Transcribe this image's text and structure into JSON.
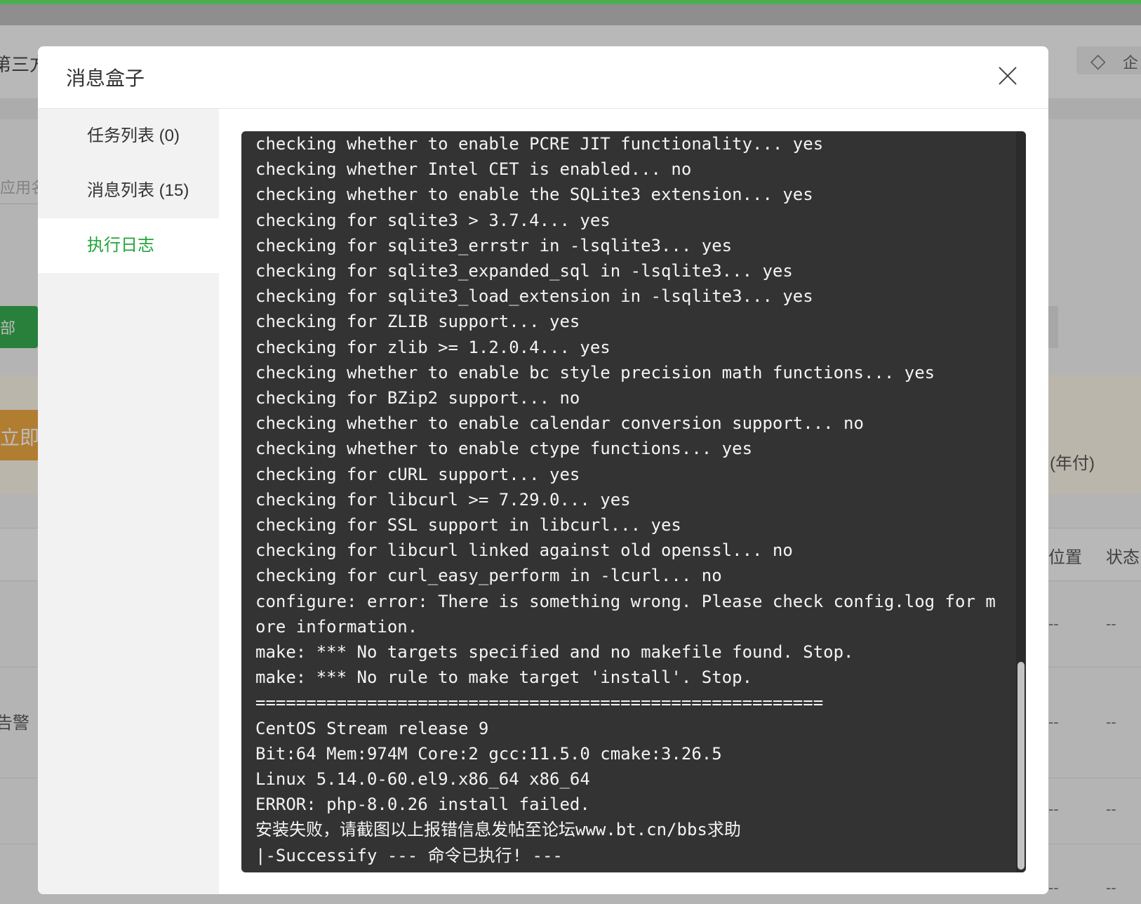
{
  "background": {
    "frag_title": "第三方",
    "frag_search": "应用名",
    "frag_green_btn": "部",
    "frag_orange_btn": "立即",
    "frag_price": "(年付)",
    "frag_col_position": "位置",
    "frag_col_status": "状态",
    "frag_alarm": "告警",
    "frag_badge": "企",
    "frag_dash": "--"
  },
  "modal": {
    "title": "消息盒子",
    "sidebar": {
      "items": [
        {
          "label": "任务列表 (0)"
        },
        {
          "label": "消息列表 (15)"
        },
        {
          "label": "执行日志"
        }
      ],
      "active_index": 2
    },
    "log_lines": [
      "checking whether to enable PCRE JIT functionality... yes",
      "checking whether Intel CET is enabled... no",
      "checking whether to enable the SQLite3 extension... yes",
      "checking for sqlite3 > 3.7.4... yes",
      "checking for sqlite3_errstr in -lsqlite3... yes",
      "checking for sqlite3_expanded_sql in -lsqlite3... yes",
      "checking for sqlite3_load_extension in -lsqlite3... yes",
      "checking for ZLIB support... yes",
      "checking for zlib >= 1.2.0.4... yes",
      "checking whether to enable bc style precision math functions... yes",
      "checking for BZip2 support... no",
      "checking whether to enable calendar conversion support... no",
      "checking whether to enable ctype functions... yes",
      "checking for cURL support... yes",
      "checking for libcurl >= 7.29.0... yes",
      "checking for SSL support in libcurl... yes",
      "checking for libcurl linked against old openssl... no",
      "checking for curl_easy_perform in -lcurl... no",
      "configure: error: There is something wrong. Please check config.log for m",
      "ore information.",
      "make: *** No targets specified and no makefile found. Stop.",
      "make: *** No rule to make target 'install'. Stop.",
      "========================================================",
      "CentOS Stream release 9",
      "Bit:64 Mem:974M Core:2 gcc:11.5.0 cmake:3.26.5",
      "Linux 5.14.0-60.el9.x86_64 x86_64",
      "ERROR: php-8.0.26 install failed.",
      "安装失败，请截图以上报错信息发帖至论坛www.bt.cn/bbs求助",
      "|-Successify --- 命令已执行! ---"
    ]
  },
  "colors": {
    "accent_green": "#20a53a",
    "terminal_bg": "#333333",
    "terminal_text": "#f4f4f4"
  }
}
